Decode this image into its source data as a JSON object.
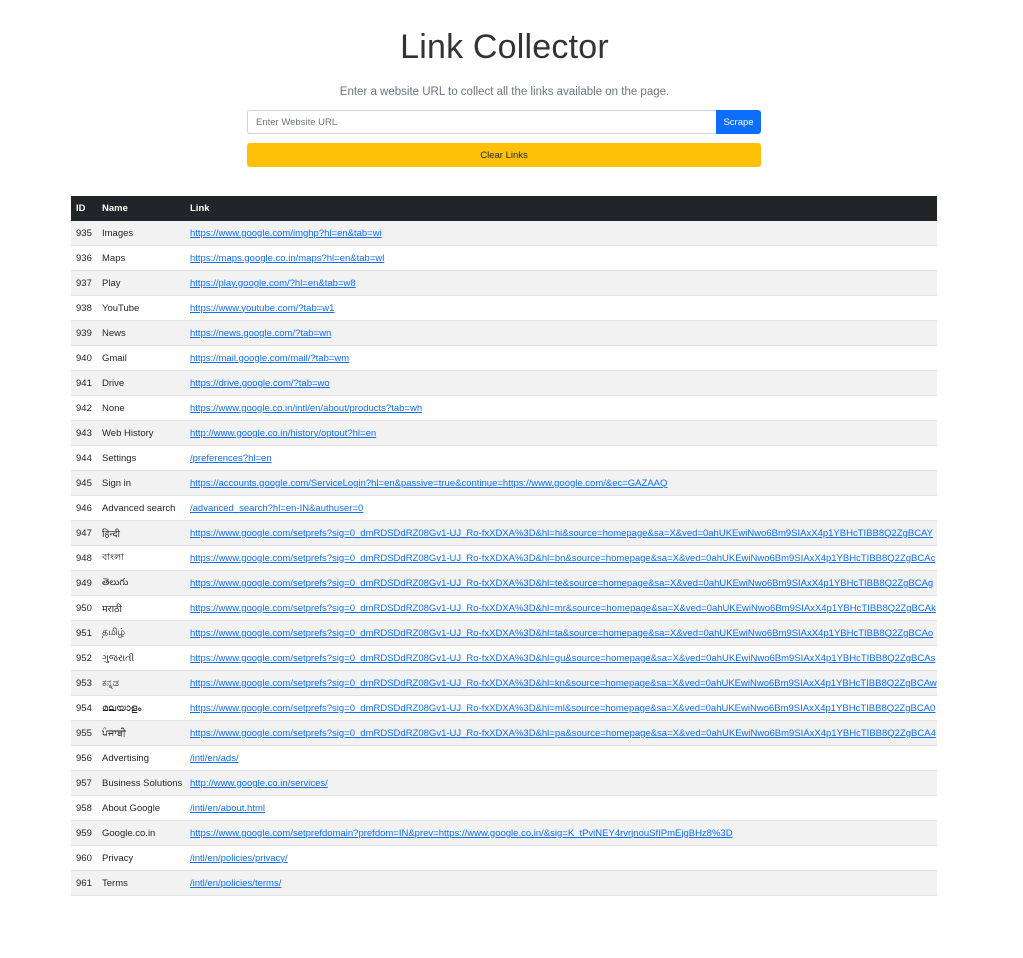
{
  "header": {
    "title": "Link Collector",
    "subtitle": "Enter a website URL to collect all the links available on the page."
  },
  "form": {
    "url_placeholder": "Enter Website URL",
    "url_value": "",
    "scrape_label": "Scrape",
    "clear_label": "Clear Links"
  },
  "table": {
    "headers": {
      "id": "ID",
      "name": "Name",
      "link": "Link"
    },
    "rows": [
      {
        "id": "935",
        "name": "Images",
        "link": "https://www.google.com/imghp?hl=en&tab=wi"
      },
      {
        "id": "936",
        "name": "Maps",
        "link": "https://maps.google.co.in/maps?hl=en&tab=wl"
      },
      {
        "id": "937",
        "name": "Play",
        "link": "https://play.google.com/?hl=en&tab=w8"
      },
      {
        "id": "938",
        "name": "YouTube",
        "link": "https://www.youtube.com/?tab=w1"
      },
      {
        "id": "939",
        "name": "News",
        "link": "https://news.google.com/?tab=wn"
      },
      {
        "id": "940",
        "name": "Gmail",
        "link": "https://mail.google.com/mail/?tab=wm"
      },
      {
        "id": "941",
        "name": "Drive",
        "link": "https://drive.google.com/?tab=wo"
      },
      {
        "id": "942",
        "name": "None",
        "link": "https://www.google.co.in/intl/en/about/products?tab=wh"
      },
      {
        "id": "943",
        "name": "Web History",
        "link": "http://www.google.co.in/history/optout?hl=en"
      },
      {
        "id": "944",
        "name": "Settings",
        "link": "/preferences?hl=en"
      },
      {
        "id": "945",
        "name": "Sign in",
        "link": "https://accounts.google.com/ServiceLogin?hl=en&passive=true&continue=https://www.google.com/&ec=GAZAAQ"
      },
      {
        "id": "946",
        "name": "Advanced search",
        "link": "/advanced_search?hl=en-IN&authuser=0"
      },
      {
        "id": "947",
        "name": "हिन्दी",
        "link": "https://www.google.com/setprefs?sig=0_dmRDSDdRZ08Gv1-UJ_Ro-fxXDXA%3D&hl=hi&source=homepage&sa=X&ved=0ahUKEwiNwo6Bm9SIAxX4p1YBHcTIBB8Q2ZgBCAY"
      },
      {
        "id": "948",
        "name": "বাংলা",
        "link": "https://www.google.com/setprefs?sig=0_dmRDSDdRZ08Gv1-UJ_Ro-fxXDXA%3D&hl=bn&source=homepage&sa=X&ved=0ahUKEwiNwo6Bm9SIAxX4p1YBHcTIBB8Q2ZgBCAc"
      },
      {
        "id": "949",
        "name": "తెలుగు",
        "link": "https://www.google.com/setprefs?sig=0_dmRDSDdRZ08Gv1-UJ_Ro-fxXDXA%3D&hl=te&source=homepage&sa=X&ved=0ahUKEwiNwo6Bm9SIAxX4p1YBHcTIBB8Q2ZgBCAg"
      },
      {
        "id": "950",
        "name": "मराठी",
        "link": "https://www.google.com/setprefs?sig=0_dmRDSDdRZ08Gv1-UJ_Ro-fxXDXA%3D&hl=mr&source=homepage&sa=X&ved=0ahUKEwiNwo6Bm9SIAxX4p1YBHcTIBB8Q2ZgBCAk"
      },
      {
        "id": "951",
        "name": "தமிழ்",
        "link": "https://www.google.com/setprefs?sig=0_dmRDSDdRZ08Gv1-UJ_Ro-fxXDXA%3D&hl=ta&source=homepage&sa=X&ved=0ahUKEwiNwo6Bm9SIAxX4p1YBHcTIBB8Q2ZgBCAo"
      },
      {
        "id": "952",
        "name": "ગુજરાતી",
        "link": "https://www.google.com/setprefs?sig=0_dmRDSDdRZ08Gv1-UJ_Ro-fxXDXA%3D&hl=gu&source=homepage&sa=X&ved=0ahUKEwiNwo6Bm9SIAxX4p1YBHcTIBB8Q2ZgBCAs"
      },
      {
        "id": "953",
        "name": "ಕನ್ನಡ",
        "link": "https://www.google.com/setprefs?sig=0_dmRDSDdRZ08Gv1-UJ_Ro-fxXDXA%3D&hl=kn&source=homepage&sa=X&ved=0ahUKEwiNwo6Bm9SIAxX4p1YBHcTIBB8Q2ZgBCAw"
      },
      {
        "id": "954",
        "name": "മലയാളം",
        "link": "https://www.google.com/setprefs?sig=0_dmRDSDdRZ08Gv1-UJ_Ro-fxXDXA%3D&hl=ml&source=homepage&sa=X&ved=0ahUKEwiNwo6Bm9SIAxX4p1YBHcTIBB8Q2ZgBCA0"
      },
      {
        "id": "955",
        "name": "ਪੰਜਾਬੀ",
        "link": "https://www.google.com/setprefs?sig=0_dmRDSDdRZ08Gv1-UJ_Ro-fxXDXA%3D&hl=pa&source=homepage&sa=X&ved=0ahUKEwiNwo6Bm9SIAxX4p1YBHcTIBB8Q2ZgBCA4"
      },
      {
        "id": "956",
        "name": "Advertising",
        "link": "/intl/en/ads/"
      },
      {
        "id": "957",
        "name": "Business Solutions",
        "link": "http://www.google.co.in/services/"
      },
      {
        "id": "958",
        "name": "About Google",
        "link": "/intl/en/about.html"
      },
      {
        "id": "959",
        "name": "Google.co.in",
        "link": "https://www.google.com/setprefdomain?prefdom=IN&prev=https://www.google.co.in/&sig=K_tPviNEY4rvrjnouSfIPmEjgBHz8%3D"
      },
      {
        "id": "960",
        "name": "Privacy",
        "link": "/intl/en/policies/privacy/"
      },
      {
        "id": "961",
        "name": "Terms",
        "link": "/intl/en/policies/terms/"
      }
    ]
  }
}
